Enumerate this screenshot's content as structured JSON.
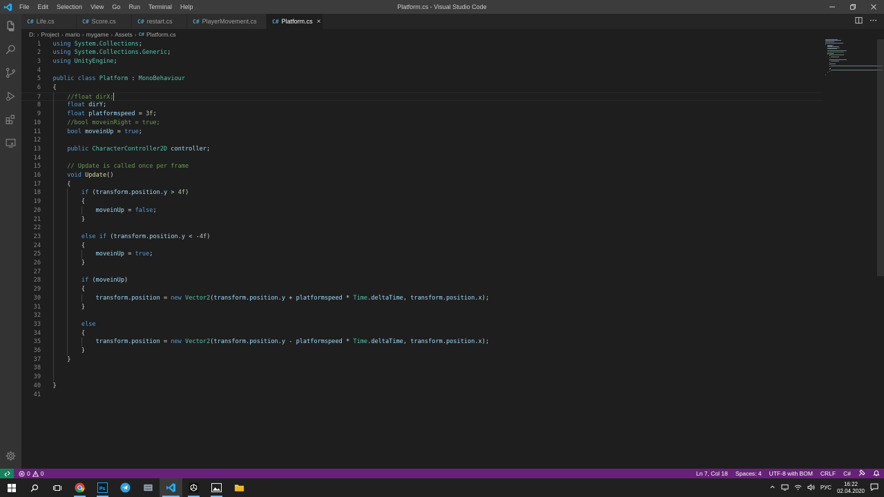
{
  "window": {
    "title": "Platform.cs - Visual Studio Code",
    "menu": [
      "File",
      "Edit",
      "Selection",
      "View",
      "Go",
      "Run",
      "Terminal",
      "Help"
    ]
  },
  "tabs": [
    {
      "label": "Life.cs",
      "active": false
    },
    {
      "label": "Score.cs",
      "active": false
    },
    {
      "label": "restart.cs",
      "active": false
    },
    {
      "label": "PlayerMovement.cs",
      "active": false
    },
    {
      "label": "Platform.cs",
      "active": true
    }
  ],
  "tab_close": "×",
  "breadcrumb": [
    "D:",
    "Project",
    "mario",
    "mygame",
    "Assets",
    "Platform.cs"
  ],
  "editor": {
    "current_line": 7,
    "lines": [
      "using System.Collections;",
      "using System.Collections.Generic;",
      "using UnityEngine;",
      "",
      "public class Platform : MonoBehaviour",
      "{",
      "    //float dirX;",
      "    float dirY;",
      "    float platformspeed = 3f;",
      "    //bool moveinRight = true;",
      "    bool moveinUp = true;",
      "",
      "    public CharacterController2D controller;",
      "",
      "    // Update is called once per frame",
      "    void Update()",
      "    {",
      "        if (transform.position.y > 4f)",
      "        {",
      "            moveinUp = false;",
      "        }",
      "",
      "        else if (transform.position.y < -4f)",
      "        {",
      "            moveinUp = true;",
      "        }",
      "",
      "        if (moveinUp)",
      "        {",
      "            transform.position = new Vector2(transform.position.y + platformspeed * Time.deltaTime, transform.position.x);",
      "        }",
      "",
      "        else",
      "        {",
      "            transform.position = new Vector2(transform.position.y - platformspeed * Time.deltaTime, transform.position.x);",
      "        }",
      "    }",
      "",
      "",
      "}",
      ""
    ]
  },
  "statusbar": {
    "errors": "0",
    "warnings": "0",
    "position": "Ln 7, Col 18",
    "spaces": "Spaces: 4",
    "encoding": "UTF-8 with BOM",
    "eol": "CRLF",
    "language": "C#"
  },
  "taskbar": {
    "language": "РУС",
    "time": "16:22",
    "date": "02.04.2020"
  },
  "colors": {
    "statusbar": "#68217a",
    "editor_bg": "#1e1e1e",
    "accent": "#007acc"
  }
}
